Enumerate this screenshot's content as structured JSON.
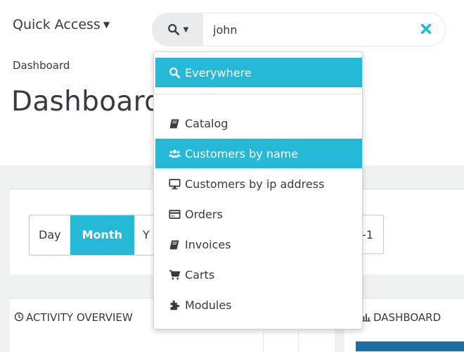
{
  "header": {
    "quick_access_label": "Quick Access",
    "search_value": "john",
    "breadcrumb": "Dashboard",
    "page_title": "Dashboard"
  },
  "search_dropdown": {
    "items": [
      {
        "label": "Everywhere",
        "icon": "search-icon",
        "active": true
      },
      {
        "label": "Catalog",
        "icon": "book-icon",
        "active": false
      },
      {
        "label": "Customers by name",
        "icon": "users-icon",
        "active": true
      },
      {
        "label": "Customers by ip address",
        "icon": "desktop-icon",
        "active": false
      },
      {
        "label": "Orders",
        "icon": "credit-card-icon",
        "active": false
      },
      {
        "label": "Invoices",
        "icon": "book-icon",
        "active": false
      },
      {
        "label": "Carts",
        "icon": "cart-icon",
        "active": false
      },
      {
        "label": "Modules",
        "icon": "puzzle-icon",
        "active": false
      }
    ]
  },
  "period_selector": {
    "day": "Day",
    "month": "Month",
    "year_partial": "Y",
    "right_partial": "-1"
  },
  "panels": {
    "activity_overview": "ACTIVITY OVERVIEW",
    "dashboard": "DASHBOARD"
  },
  "colors": {
    "accent": "#25b9d7",
    "text": "#363a41",
    "background": "#eff1f2"
  }
}
